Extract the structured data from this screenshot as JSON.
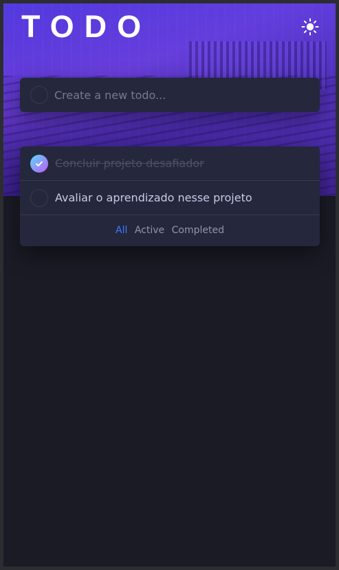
{
  "header": {
    "title": "TODO",
    "theme_icon": "sun-icon"
  },
  "new_todo": {
    "placeholder": "Create a new todo..."
  },
  "todos": [
    {
      "text": "Concluir projeto desafiador",
      "completed": true
    },
    {
      "text": "Avaliar o aprendizado nesse projeto",
      "completed": false
    }
  ],
  "filters": {
    "all": "All",
    "active": "Active",
    "completed": "Completed",
    "selected": "All"
  },
  "colors": {
    "accent": "#3a7cfd",
    "check_gradient_start": "#57ddff",
    "check_gradient_end": "#c058f3",
    "card_background": "#25273d",
    "page_background": "#1a1b25"
  }
}
